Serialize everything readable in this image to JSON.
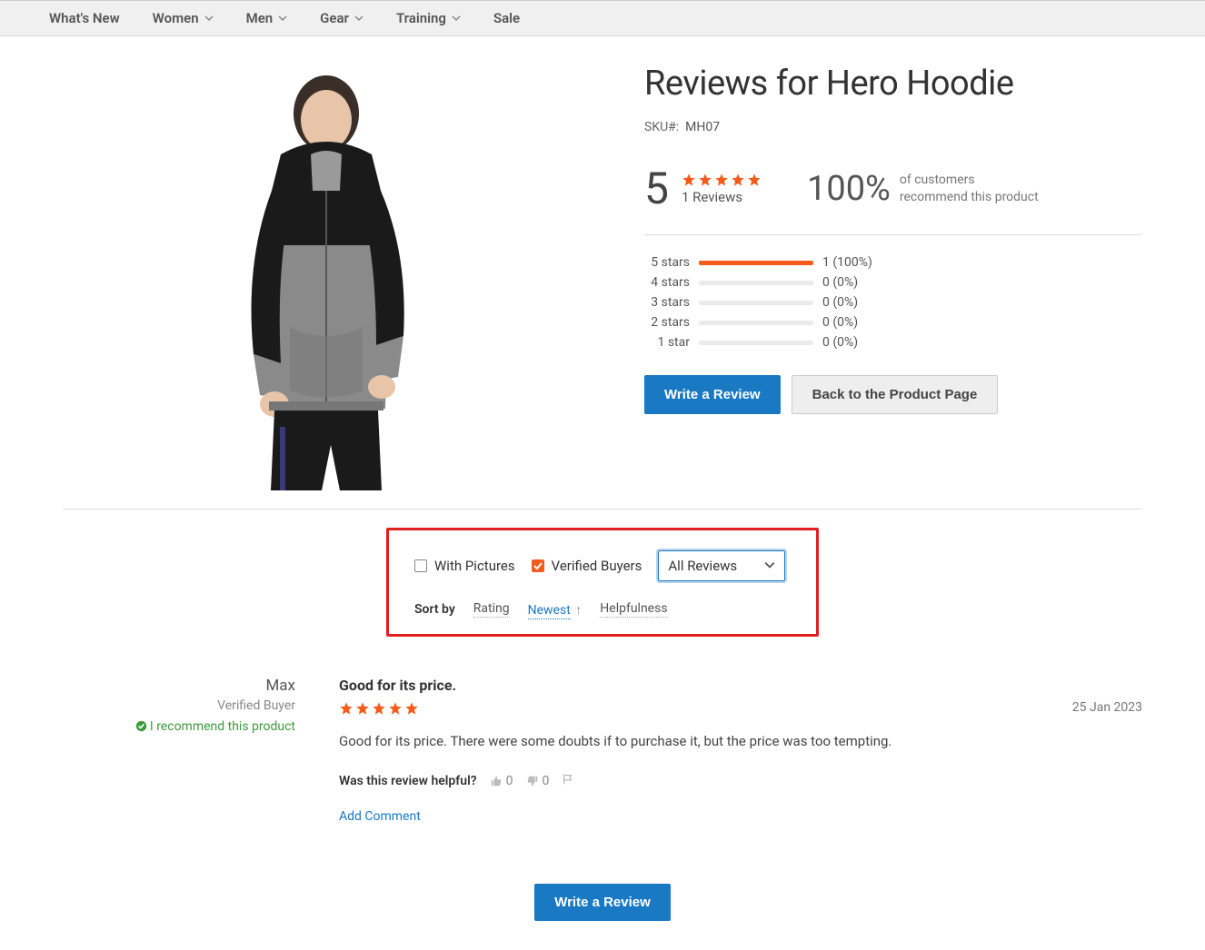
{
  "nav": {
    "items": [
      {
        "label": "What's New",
        "has_children": false
      },
      {
        "label": "Women",
        "has_children": true
      },
      {
        "label": "Men",
        "has_children": true
      },
      {
        "label": "Gear",
        "has_children": true
      },
      {
        "label": "Training",
        "has_children": true
      },
      {
        "label": "Sale",
        "has_children": false
      }
    ]
  },
  "product": {
    "title": "Reviews for Hero Hoodie",
    "sku_label": "SKU#:",
    "sku_value": "MH07"
  },
  "summary": {
    "avg": "5",
    "review_count": "1 Reviews",
    "recommend_pct": "100%",
    "recommend_text_l1": "of customers",
    "recommend_text_l2": "recommend this product"
  },
  "distribution": [
    {
      "label": "5 stars",
      "pct": 100,
      "count": "1 (100%)"
    },
    {
      "label": "4 stars",
      "pct": 0,
      "count": "0 (0%)"
    },
    {
      "label": "3 stars",
      "pct": 0,
      "count": "0 (0%)"
    },
    {
      "label": "2 stars",
      "pct": 0,
      "count": "0 (0%)"
    },
    {
      "label": "1 star",
      "pct": 0,
      "count": "0 (0%)"
    }
  ],
  "buttons": {
    "write": "Write a Review",
    "back": "Back to the Product Page"
  },
  "filters": {
    "with_pictures": "With Pictures",
    "verified_buyers": "Verified Buyers",
    "dropdown_selected": "All Reviews",
    "sort_label": "Sort by",
    "sort_options": [
      "Rating",
      "Newest",
      "Helpfulness"
    ],
    "sort_active": "Newest"
  },
  "review": {
    "name": "Max",
    "verified": "Verified Buyer",
    "recommend": "I recommend this product",
    "title": "Good for its price.",
    "body": "Good for its price. There were some doubts if to purchase it, but the price was too tempting.",
    "date": "25 Jan 2023",
    "helpful_label": "Was this review helpful?",
    "up": "0",
    "down": "0",
    "add_comment": "Add Comment"
  },
  "bottom": {
    "write": "Write a Review"
  }
}
